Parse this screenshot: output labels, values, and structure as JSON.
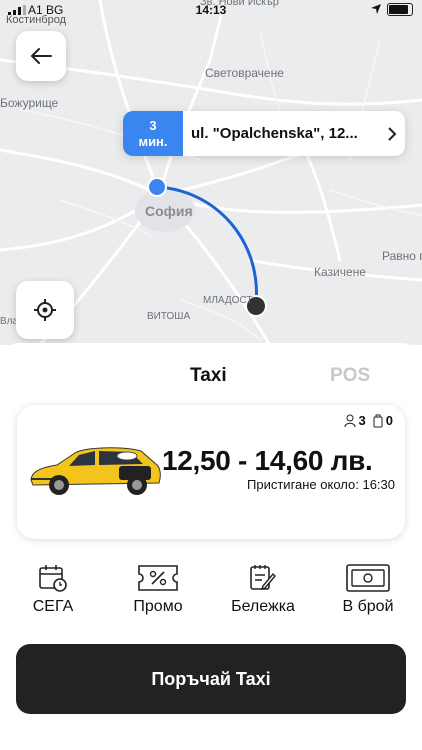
{
  "status_bar": {
    "carrier": "A1 BG",
    "network_label": "Костинброд",
    "time": "14:13"
  },
  "map": {
    "labels": {
      "top": "Зв. Нови Искър",
      "svetovrachene": "Световрачене",
      "bozhurishte": "Божурище",
      "sofia": "София",
      "ravno_pole": "Равно п",
      "kazichene": "Казичене",
      "mladost": "МЛАДОСТ",
      "vitosha": "ВИТОША",
      "vla": "Вла"
    },
    "eta": {
      "minutes": "3",
      "unit": "мин.",
      "address": "ul. \"Opalchenska\", 12..."
    }
  },
  "tabs": [
    {
      "label": "Taxi",
      "active": true
    },
    {
      "label": "POS",
      "active": false
    }
  ],
  "offer": {
    "passengers": "3",
    "luggage": "0",
    "price": "12,50  - 14,60 лв.",
    "arrival": "Пристигане около: 16:30"
  },
  "options": [
    {
      "label": "СЕГА",
      "icon": "calendar-clock-icon"
    },
    {
      "label": "Промо",
      "icon": "promo-ticket-icon"
    },
    {
      "label": "Бележка",
      "icon": "note-pencil-icon"
    },
    {
      "label": "В брой",
      "icon": "cash-icon"
    }
  ],
  "order_button": "Поръчай Taxi",
  "colors": {
    "accent": "#3a86f0",
    "button": "#222220",
    "taxi": "#f3c41c"
  }
}
